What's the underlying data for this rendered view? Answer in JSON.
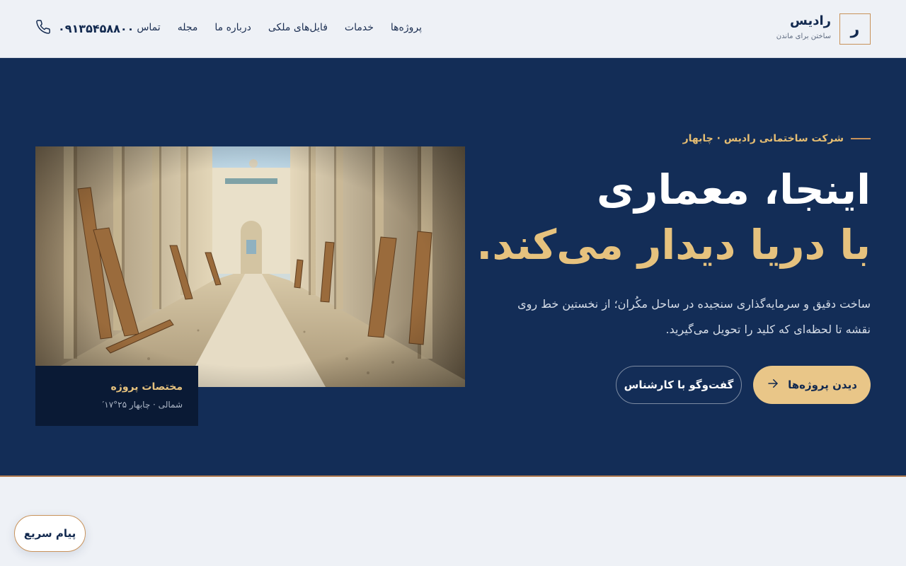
{
  "brand": {
    "logo_letter": "ر",
    "name": "رادیس",
    "tagline": "ساختن برای ماندن"
  },
  "nav": {
    "items": [
      {
        "label": "پروژه‌ها"
      },
      {
        "label": "خدمات"
      },
      {
        "label": "فایل‌های ملکی"
      },
      {
        "label": "درباره ما"
      },
      {
        "label": "مجله"
      },
      {
        "label": "تماس"
      }
    ]
  },
  "contact": {
    "phone": "۰۹۱۳۵۴۵۸۸۰۰",
    "icon": "phone-icon"
  },
  "hero": {
    "eyebrow": "شرکت ساختمانی رادیس · چابهار",
    "title_line1": "اینجا، معماری",
    "title_line2": "با دریا دیدار می‌کند.",
    "description": "ساخت دقیق و سرمایه‌گذاری سنجیده در ساحل مکُران؛ از نخستین خط روی نقشه تا لحظه‌ای که کلید را تحویل می‌گیرید.",
    "primary_button": "دیدن پروژه‌ها",
    "secondary_button": "گفت‌وگو با کارشناس"
  },
  "project_coordinates": {
    "title": "مختصات پروژه",
    "value": "شمالی · چابهار ۲۵°۱۷′"
  },
  "quick_message": {
    "label": "پیام سریع"
  },
  "colors": {
    "navy": "#132d57",
    "gold": "#e6c27e",
    "accent": "#c8925a",
    "background": "#eef1f6"
  }
}
